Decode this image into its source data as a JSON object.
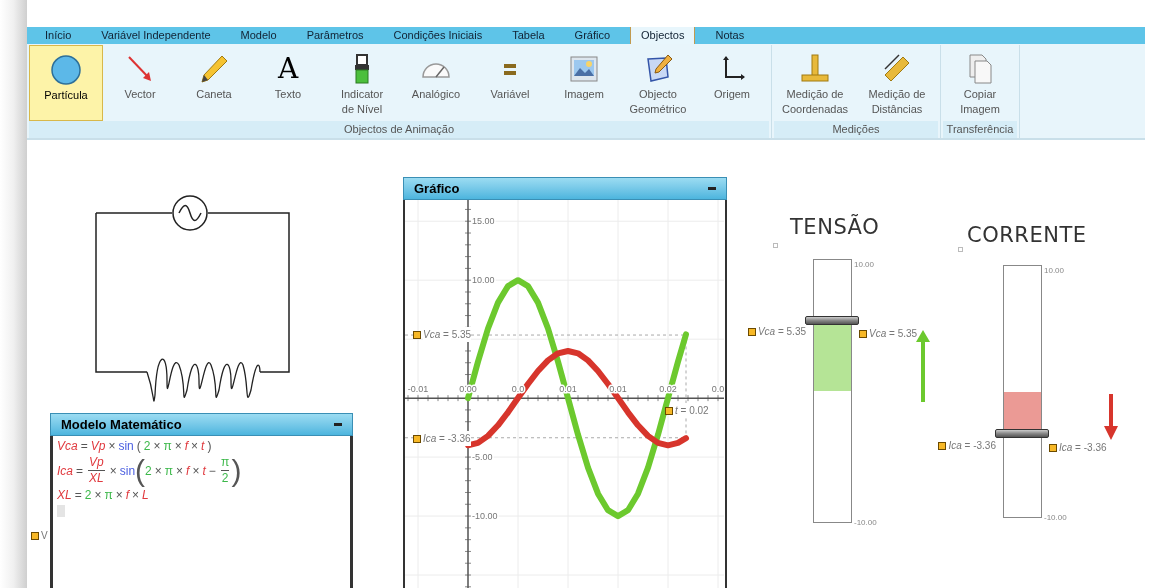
{
  "tabs": [
    {
      "label": "Início",
      "selected": false
    },
    {
      "label": "Variável Independente",
      "selected": false
    },
    {
      "label": "Modelo",
      "selected": false
    },
    {
      "label": "Parâmetros",
      "selected": false
    },
    {
      "label": "Condições Iniciais",
      "selected": false
    },
    {
      "label": "Tabela",
      "selected": false
    },
    {
      "label": "Gráfico",
      "selected": false
    },
    {
      "label": "Objectos",
      "selected": true
    },
    {
      "label": "Notas",
      "selected": false
    }
  ],
  "ribbon": {
    "groups": [
      {
        "label": "Objectos de Animação",
        "items": [
          {
            "kind": "particle",
            "lines": [
              "Partícula"
            ],
            "selected": true
          },
          {
            "kind": "vector",
            "lines": [
              "Vector"
            ],
            "selected": false
          },
          {
            "kind": "pen",
            "lines": [
              "Caneta"
            ],
            "selected": false
          },
          {
            "kind": "text",
            "glyph": "A",
            "lines": [
              "Texto"
            ],
            "selected": false
          },
          {
            "kind": "level",
            "lines": [
              "Indicator",
              "de Nível"
            ],
            "selected": false
          },
          {
            "kind": "analog",
            "lines": [
              "Analógico"
            ],
            "selected": false
          },
          {
            "kind": "variable",
            "lines": [
              "Variável"
            ],
            "selected": false
          },
          {
            "kind": "image",
            "lines": [
              "Imagem"
            ],
            "selected": false
          },
          {
            "kind": "geometric",
            "lines": [
              "Objecto",
              "Geométrico"
            ],
            "selected": false
          },
          {
            "kind": "origin",
            "lines": [
              "Origem"
            ],
            "selected": false
          }
        ]
      },
      {
        "label": "Medições",
        "items": [
          {
            "kind": "coordinates",
            "lines": [
              "Medição de",
              "Coordenadas"
            ],
            "selected": false
          },
          {
            "kind": "distances",
            "lines": [
              "Medição de",
              "Distâncias"
            ],
            "selected": false
          }
        ]
      },
      {
        "label": "Transferência",
        "items": [
          {
            "kind": "copy",
            "lines": [
              "Copiar",
              "Imagem"
            ],
            "selected": false
          }
        ]
      }
    ]
  },
  "canvas_marker": {
    "text": "V"
  },
  "model_window": {
    "title": "Modelo Matemático",
    "equations": [
      {
        "tokens": [
          {
            "kind": "var",
            "text": "Vca"
          },
          {
            "kind": "op",
            "text": "="
          },
          {
            "kind": "var",
            "text": "Vp"
          },
          {
            "kind": "op",
            "text": "×"
          },
          {
            "kind": "func",
            "text": "sin"
          },
          {
            "kind": "op",
            "text": "("
          },
          {
            "kind": "num",
            "text": "2"
          },
          {
            "kind": "op",
            "text": "×"
          },
          {
            "kind": "num",
            "text": "π"
          },
          {
            "kind": "op",
            "text": "×"
          },
          {
            "kind": "var",
            "text": "f"
          },
          {
            "kind": "op",
            "text": "×"
          },
          {
            "kind": "var",
            "text": "t"
          },
          {
            "kind": "op",
            "text": ")"
          }
        ]
      },
      {
        "tokens": [
          {
            "kind": "var",
            "text": "Ica"
          },
          {
            "kind": "op",
            "text": "="
          },
          {
            "kind": "frac",
            "top": {
              "kind": "var",
              "text": "Vp"
            },
            "bottom": {
              "kind": "var",
              "text": "XL"
            }
          },
          {
            "kind": "op",
            "text": "×"
          },
          {
            "kind": "func",
            "text": "sin"
          },
          {
            "kind": "bigparen",
            "text": "("
          },
          {
            "kind": "num",
            "text": "2"
          },
          {
            "kind": "op",
            "text": "×"
          },
          {
            "kind": "num",
            "text": "π"
          },
          {
            "kind": "op",
            "text": "×"
          },
          {
            "kind": "var",
            "text": "f"
          },
          {
            "kind": "op",
            "text": "×"
          },
          {
            "kind": "var",
            "text": "t"
          },
          {
            "kind": "op",
            "text": "−"
          },
          {
            "kind": "frac",
            "top": {
              "kind": "num",
              "text": "π"
            },
            "bottom": {
              "kind": "num",
              "text": "2"
            }
          },
          {
            "kind": "bigparen",
            "text": ")"
          }
        ]
      },
      {
        "tokens": [
          {
            "kind": "var",
            "text": "XL"
          },
          {
            "kind": "op",
            "text": "="
          },
          {
            "kind": "num",
            "text": "2"
          },
          {
            "kind": "op",
            "text": "×"
          },
          {
            "kind": "num",
            "text": "π"
          },
          {
            "kind": "op",
            "text": "×"
          },
          {
            "kind": "var",
            "text": "f"
          },
          {
            "kind": "op",
            "text": "×"
          },
          {
            "kind": "var",
            "text": "L"
          }
        ]
      }
    ]
  },
  "graph_window": {
    "title": "Gráfico",
    "chart_data": {
      "type": "line",
      "x": [
        0,
        0.001,
        0.002,
        0.003,
        0.004,
        0.005,
        0.006,
        0.007,
        0.008,
        0.009,
        0.01,
        0.011,
        0.012,
        0.013,
        0.014,
        0.015,
        0.016,
        0.017,
        0.018,
        0.019,
        0.02,
        0.021,
        0.0218
      ],
      "series": [
        {
          "color": "#6cc92e",
          "values": [
            0,
            3.1,
            5.9,
            8.1,
            9.5,
            10,
            9.5,
            8.1,
            5.9,
            3.1,
            0,
            -3.1,
            -5.9,
            -8.1,
            -9.5,
            -10,
            -9.5,
            -8.1,
            -5.9,
            -3.1,
            0,
            3.1,
            5.4
          ]
        },
        {
          "color": "#d7352c",
          "values": [
            -4,
            -3.8,
            -3.2,
            -2.3,
            -1.2,
            0,
            1.2,
            2.3,
            3.2,
            3.8,
            4,
            3.8,
            3.2,
            2.3,
            1.2,
            0,
            -1.2,
            -2.3,
            -3.2,
            -3.8,
            -4,
            -3.8,
            -3.4
          ]
        }
      ],
      "xlim": [
        -0.0063,
        0.0256
      ],
      "ylim": [
        -16.1,
        16.8
      ],
      "grid": true,
      "ref_lines": [
        {
          "axis": "y",
          "value": 5.35
        },
        {
          "axis": "y",
          "value": -3.36
        },
        {
          "axis": "x",
          "value": 0.0218
        }
      ],
      "xticks": [
        {
          "value": -0.005,
          "label": "-0.01"
        },
        {
          "value": 0,
          "label": "0.00"
        },
        {
          "value": 0.005,
          "label": "0.0"
        },
        {
          "value": 0.01,
          "label": "0.01"
        },
        {
          "value": 0.015,
          "label": "0.01"
        },
        {
          "value": 0.02,
          "label": "0.02"
        },
        {
          "value": 0.025,
          "label": "0.0"
        }
      ],
      "yticks": [
        {
          "value": 15,
          "label": "15.00"
        },
        {
          "value": 10,
          "label": "10.00"
        },
        {
          "value": -5,
          "label": "-5.00"
        },
        {
          "value": -10,
          "label": "-10.00"
        }
      ]
    },
    "readouts": [
      {
        "text": "*Vca* = 5.35"
      },
      {
        "text": "*Ica* = -3.36"
      },
      {
        "text": "*t* = 0.02"
      }
    ]
  },
  "meters": [
    {
      "title": "TENSÃO",
      "top_label": "10.00",
      "bottom_label": "-10.00",
      "level": 0.7675,
      "color": "#6cc92e",
      "readouts": [
        "*Vca* = 5.35",
        "*Vca* = 5.35"
      ]
    },
    {
      "title": "CORRENTE",
      "top_label": "10.00",
      "bottom_label": "-10.00",
      "level": 0.332,
      "color": "#d7352c",
      "readouts": [
        "*Ica* = -3.36",
        "*Ica* = -3.36"
      ]
    }
  ]
}
